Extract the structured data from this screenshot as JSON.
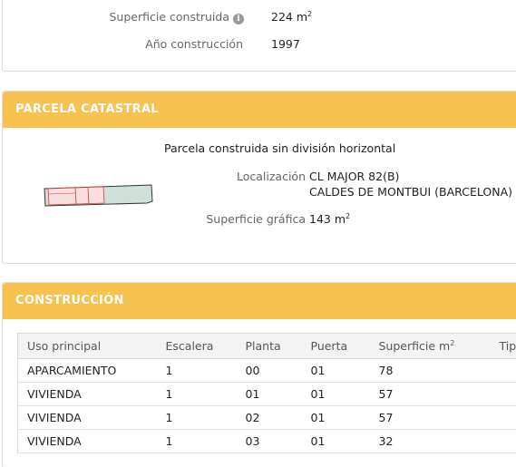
{
  "top": {
    "superficie_construida": {
      "label": "Superficie construida",
      "value": "224 m",
      "sup": "2"
    },
    "anio_construccion": {
      "label": "Año construcción",
      "value": "1997"
    }
  },
  "parcela": {
    "header": "PARCELA CATASTRAL",
    "title": "Parcela construida sin división horizontal",
    "localizacion_label": "Localización",
    "localizacion_line1": "CL MAJOR 82(B)",
    "localizacion_line2": "CALDES DE MONTBUI (BARCELONA)",
    "superficie_grafica_label": "Superficie gráfica",
    "superficie_grafica_value": "143 m",
    "superficie_grafica_sup": "2"
  },
  "construccion": {
    "header": "CONSTRUCCIÓN",
    "columns": [
      "Uso principal",
      "Escalera",
      "Planta",
      "Puerta",
      "Superficie m",
      "Tipo"
    ],
    "superficie_sup": "2",
    "rows": [
      [
        "APARCAMIENTO",
        "1",
        "00",
        "01",
        "78",
        ""
      ],
      [
        "VIVIENDA",
        "1",
        "01",
        "01",
        "57",
        ""
      ],
      [
        "VIVIENDA",
        "1",
        "02",
        "01",
        "57",
        ""
      ],
      [
        "VIVIENDA",
        "1",
        "03",
        "01",
        "32",
        ""
      ]
    ]
  },
  "colors": {
    "header_bg": "#f7c24f",
    "header_text": "#ffffff",
    "parcel_fill": "#cfe0d8",
    "parcel_highlight": "#f8dede",
    "parcel_line": "#d23b3b"
  },
  "icons": {
    "info": "info-icon"
  }
}
